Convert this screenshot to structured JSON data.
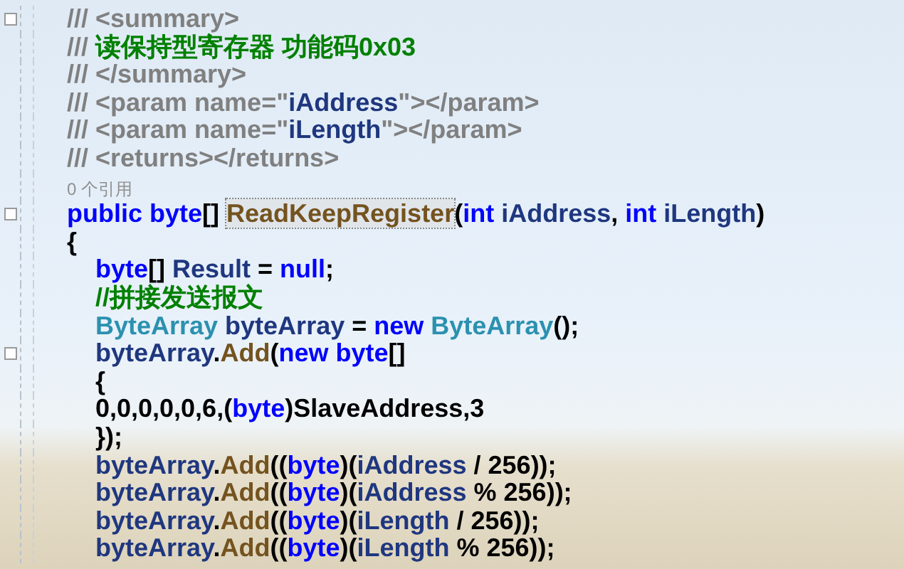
{
  "lines": [
    {
      "collapsible": true,
      "tokens": [
        {
          "kind": "doc",
          "text": "/// <summary>"
        }
      ]
    },
    {
      "collapsible": false,
      "tokens": [
        {
          "kind": "doc",
          "text": "///"
        },
        {
          "kind": "comment",
          "text": " 读保持型寄存器 功能码0x03"
        }
      ]
    },
    {
      "collapsible": false,
      "tokens": [
        {
          "kind": "doc",
          "text": "/// </summary>"
        }
      ]
    },
    {
      "collapsible": false,
      "tokens": [
        {
          "kind": "doc",
          "text": "/// <param name=\""
        },
        {
          "kind": "ident",
          "text": "iAddress"
        },
        {
          "kind": "doc",
          "text": "\"></param>"
        }
      ]
    },
    {
      "collapsible": false,
      "tokens": [
        {
          "kind": "doc",
          "text": "/// <param name=\""
        },
        {
          "kind": "ident",
          "text": "iLength"
        },
        {
          "kind": "doc",
          "text": "\"></param>"
        }
      ]
    },
    {
      "collapsible": false,
      "tokens": [
        {
          "kind": "doc",
          "text": "/// <returns></returns>"
        }
      ]
    },
    {
      "collapsible": false,
      "tokens": [
        {
          "kind": "lens",
          "text": "0 个引用"
        }
      ]
    },
    {
      "collapsible": true,
      "tokens": [
        {
          "kind": "keyword",
          "text": "public byte"
        },
        {
          "kind": "punct",
          "text": "[] "
        },
        {
          "kind": "method-highlight",
          "text": "ReadKeepRegister"
        },
        {
          "kind": "punct",
          "text": "("
        },
        {
          "kind": "keyword",
          "text": "int"
        },
        {
          "kind": "ident",
          "text": " iAddress"
        },
        {
          "kind": "punct",
          "text": ", "
        },
        {
          "kind": "keyword",
          "text": "int"
        },
        {
          "kind": "ident",
          "text": " iLength"
        },
        {
          "kind": "punct",
          "text": ")"
        }
      ]
    },
    {
      "collapsible": false,
      "tokens": [
        {
          "kind": "punct",
          "text": "{"
        }
      ],
      "children": [
        {
          "collapsible": false,
          "tokens": [
            {
              "kind": "keyword",
              "text": "byte"
            },
            {
              "kind": "punct",
              "text": "[] "
            },
            {
              "kind": "ident",
              "text": "Result"
            },
            {
              "kind": "punct",
              "text": " = "
            },
            {
              "kind": "keyword",
              "text": "null"
            },
            {
              "kind": "punct",
              "text": ";"
            }
          ]
        },
        {
          "collapsible": false,
          "tokens": [
            {
              "kind": "comment",
              "text": "//拼接发送报文"
            }
          ]
        },
        {
          "collapsible": false,
          "tokens": [
            {
              "kind": "type",
              "text": "ByteArray"
            },
            {
              "kind": "ident",
              "text": " byteArray"
            },
            {
              "kind": "punct",
              "text": " = "
            },
            {
              "kind": "keyword",
              "text": "new"
            },
            {
              "kind": "type",
              "text": " ByteArray"
            },
            {
              "kind": "punct",
              "text": "();"
            }
          ]
        },
        {
          "collapsible": true,
          "tokens": [
            {
              "kind": "ident",
              "text": "byteArray"
            },
            {
              "kind": "punct",
              "text": "."
            },
            {
              "kind": "method",
              "text": "Add"
            },
            {
              "kind": "punct",
              "text": "("
            },
            {
              "kind": "keyword",
              "text": "new byte"
            },
            {
              "kind": "punct",
              "text": "[]"
            }
          ]
        },
        {
          "collapsible": false,
          "tokens": [
            {
              "kind": "punct",
              "text": "{"
            }
          ]
        },
        {
          "collapsible": false,
          "tokens": [
            {
              "kind": "punct",
              "text": "0,0,0,0,0,6,("
            },
            {
              "kind": "keyword",
              "text": "byte"
            },
            {
              "kind": "punct",
              "text": ")SlaveAddress,3"
            }
          ]
        },
        {
          "collapsible": false,
          "tokens": [
            {
              "kind": "punct",
              "text": "});"
            }
          ]
        },
        {
          "collapsible": false,
          "tokens": [
            {
              "kind": "ident",
              "text": "byteArray"
            },
            {
              "kind": "punct",
              "text": "."
            },
            {
              "kind": "method",
              "text": "Add"
            },
            {
              "kind": "punct",
              "text": "(("
            },
            {
              "kind": "keyword",
              "text": "byte"
            },
            {
              "kind": "punct",
              "text": ")("
            },
            {
              "kind": "ident",
              "text": "iAddress"
            },
            {
              "kind": "punct",
              "text": " / 256));"
            }
          ]
        },
        {
          "collapsible": false,
          "tokens": [
            {
              "kind": "ident",
              "text": "byteArray"
            },
            {
              "kind": "punct",
              "text": "."
            },
            {
              "kind": "method",
              "text": "Add"
            },
            {
              "kind": "punct",
              "text": "(("
            },
            {
              "kind": "keyword",
              "text": "byte"
            },
            {
              "kind": "punct",
              "text": ")("
            },
            {
              "kind": "ident",
              "text": "iAddress"
            },
            {
              "kind": "punct",
              "text": " % 256));"
            }
          ]
        },
        {
          "collapsible": false,
          "tokens": [
            {
              "kind": "ident",
              "text": "byteArray"
            },
            {
              "kind": "punct",
              "text": "."
            },
            {
              "kind": "method",
              "text": "Add"
            },
            {
              "kind": "punct",
              "text": "(("
            },
            {
              "kind": "keyword",
              "text": "byte"
            },
            {
              "kind": "punct",
              "text": ")("
            },
            {
              "kind": "ident",
              "text": "iLength"
            },
            {
              "kind": "punct",
              "text": " / 256));"
            }
          ]
        },
        {
          "collapsible": false,
          "tokens": [
            {
              "kind": "ident",
              "text": "byteArray"
            },
            {
              "kind": "punct",
              "text": "."
            },
            {
              "kind": "method",
              "text": "Add"
            },
            {
              "kind": "punct",
              "text": "(("
            },
            {
              "kind": "keyword",
              "text": "byte"
            },
            {
              "kind": "punct",
              "text": ")("
            },
            {
              "kind": "ident",
              "text": "iLength"
            },
            {
              "kind": "punct",
              "text": " % 256));"
            }
          ]
        }
      ]
    }
  ]
}
